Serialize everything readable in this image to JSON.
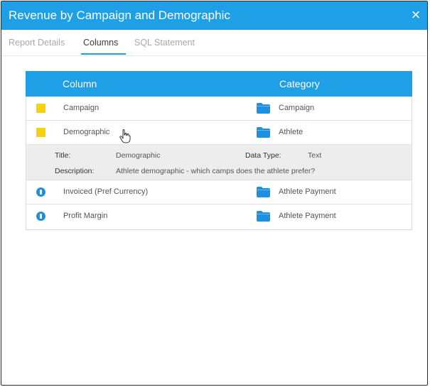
{
  "dialog": {
    "title": "Revenue by Campaign and Demographic",
    "close_glyph": "×"
  },
  "tabs": [
    {
      "label": "Report Details",
      "active": false
    },
    {
      "label": "Columns",
      "active": true
    },
    {
      "label": "SQL Statement",
      "active": false
    }
  ],
  "grid": {
    "headers": {
      "column": "Column",
      "category": "Category"
    },
    "rows": [
      {
        "icon": "dimension-square-icon",
        "column": "Campaign",
        "category": "Campaign",
        "category_icon": "folder-icon"
      },
      {
        "icon": "dimension-square-icon",
        "column": "Demographic",
        "category": "Athlete",
        "category_icon": "folder-icon",
        "expanded": true
      },
      {
        "icon": "metric-circle-icon",
        "column": "Invoiced (Pref Currency)",
        "category": "Athlete Payment",
        "category_icon": "folder-icon"
      },
      {
        "icon": "metric-circle-icon",
        "column": "Profit Margin",
        "category": "Athlete Payment",
        "category_icon": "folder-icon"
      }
    ],
    "details": {
      "title_label": "Title:",
      "title_value": "Demographic",
      "datatype_label": "Data Type:",
      "datatype_value": "Text",
      "description_label": "Description:",
      "description_value": "Athlete demographic - which camps does the athlete prefer?"
    }
  },
  "colors": {
    "accent": "#1e9fe6",
    "dimension_icon": "#f6d20e",
    "metric_icon": "#1e90e0",
    "details_bg": "#ededed"
  }
}
